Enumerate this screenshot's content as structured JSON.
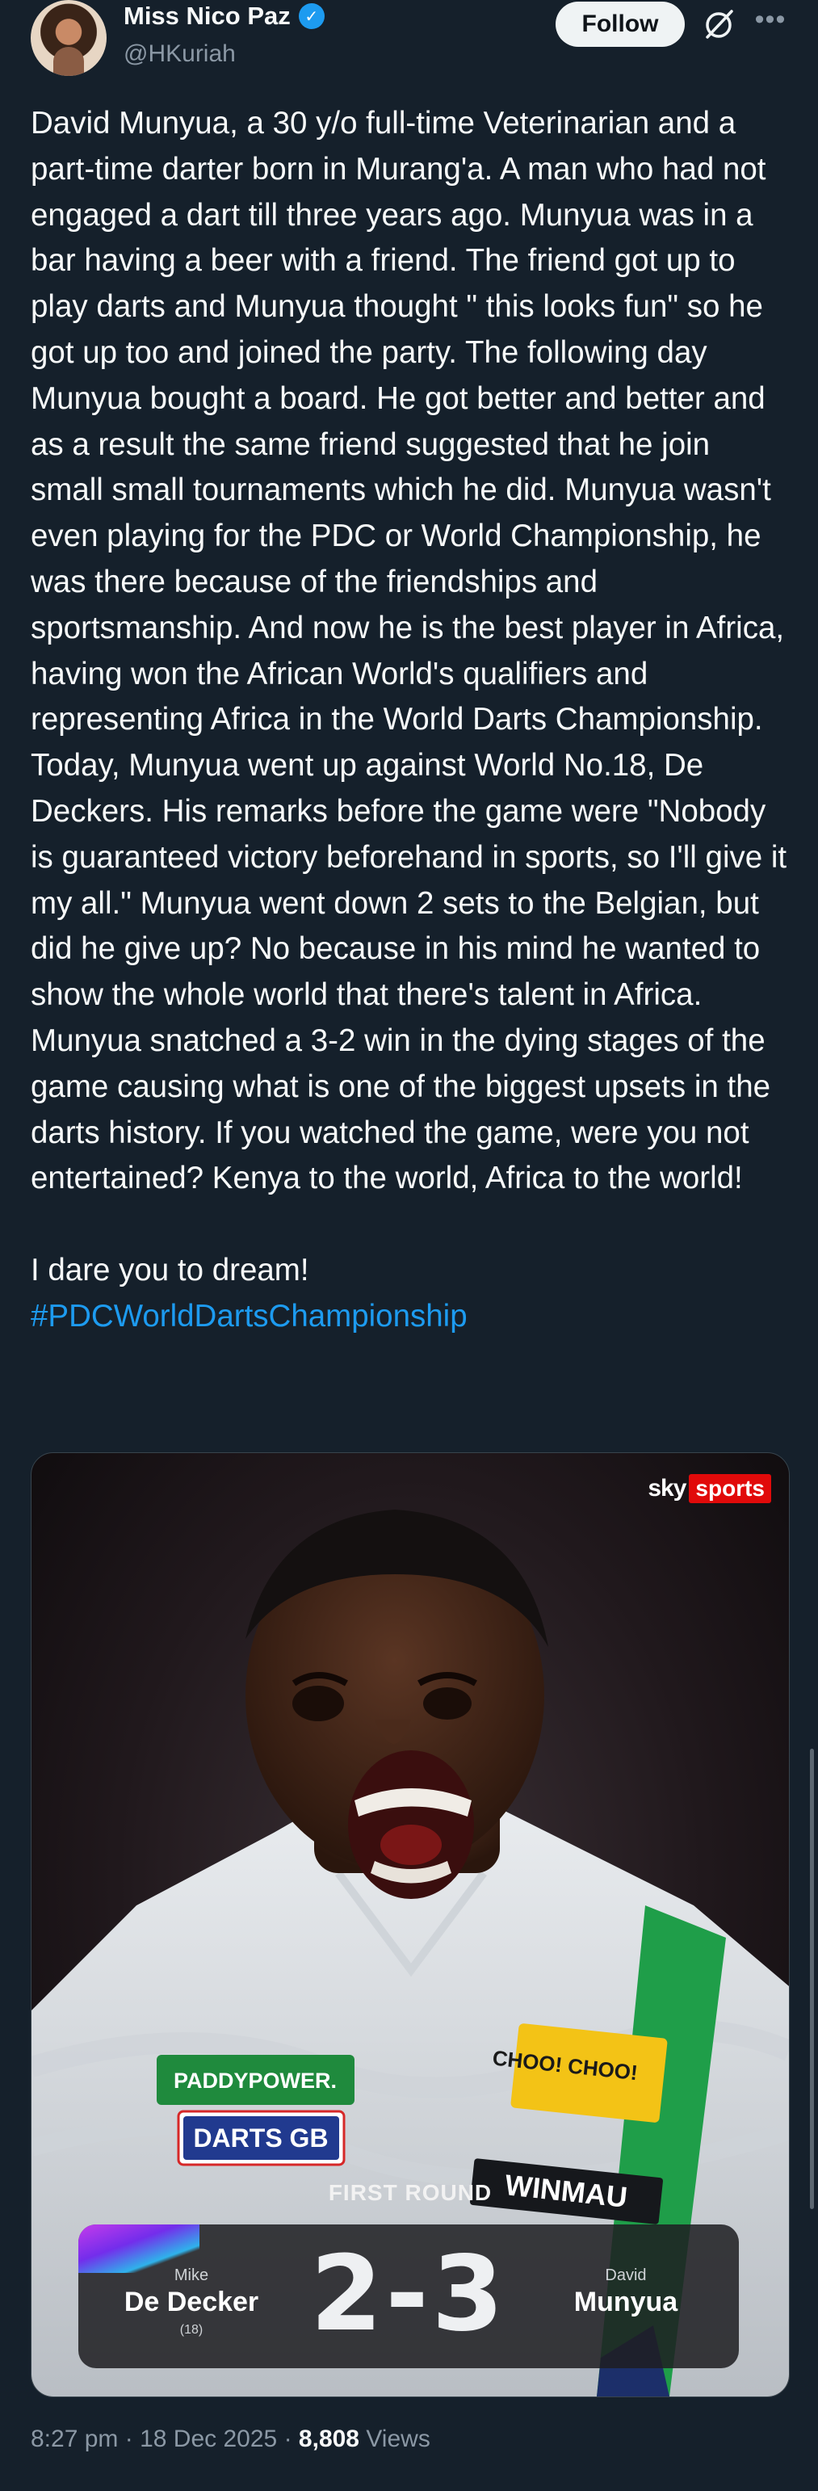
{
  "author": {
    "display_name": "Miss Nico Paz",
    "handle": "@HKuriah",
    "verified_glyph": "✓"
  },
  "actions": {
    "follow_label": "Follow",
    "more_glyph": "•••"
  },
  "tweet": {
    "paragraph_1": "David Munyua, a 30 y/o full-time Veterinarian and a part-time darter born in Murang'a. A man who had not engaged a dart till three years ago. Munyua was in a bar having a beer with a friend. The friend got up to play darts and Munyua thought \" this looks fun\" so he got up too and joined the party. The following day Munyua bought a board. He got better and better and as a result the same friend suggested that he join small small tournaments which he did. Munyua wasn't even playing for the PDC or World Championship, he was there because of the friendships and sportsmanship. And now he is the best player in Africa, having won the African World's qualifiers and representing Africa in the World Darts Championship.",
    "paragraph_2": "Today, Munyua went up against World No.18, De Deckers. His remarks before the game were \"Nobody is guaranteed victory beforehand in sports, so I'll give it my all.\" Munyua went down 2 sets to the Belgian, but did he give up? No because in his mind he wanted to show the whole world that there's talent in Africa. Munyua snatched a 3-2 win in the dying stages of the game causing what is one of the biggest upsets in the darts history. If you watched the game, were you not entertained? Kenya to the world, Africa to the world!",
    "paragraph_3": "I dare you to dream!",
    "hashtag": "#PDCWorldDartsChampionship"
  },
  "media": {
    "broadcaster_sky": "sky",
    "broadcaster_sports": "sports",
    "shirt_sponsor_1": "PADDYPOWER.",
    "shirt_sponsor_2": "DARTS GB",
    "shirt_sponsor_3": "CHOO! CHOO!",
    "shirt_sponsor_4": "WINMAU",
    "round": "FIRST ROUND",
    "player_left_first": "Mike",
    "player_left_last": "De Decker",
    "player_left_rank": "(18)",
    "score": "2-3",
    "player_right_first": "David",
    "player_right_last": "Munyua"
  },
  "meta": {
    "time": "8:27 pm",
    "date": "18 Dec 2025",
    "views_count": "8,808",
    "views_label": "Views",
    "separator": "·"
  },
  "colors": {
    "background": "#15202b",
    "text": "#f7f9f9",
    "secondary": "#8b98a5",
    "link": "#1d9bf0",
    "verified": "#1d9bf0"
  }
}
